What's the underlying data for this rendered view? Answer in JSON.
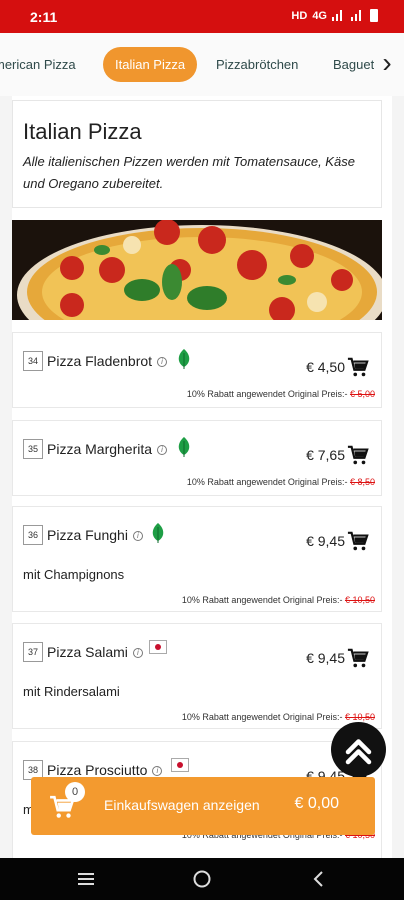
{
  "status": {
    "time": "2:11",
    "network": "4G"
  },
  "categories": {
    "tabs": [
      {
        "label": "merican Pizza"
      },
      {
        "label": "Italian Pizza"
      },
      {
        "label": "Pizzabrötchen"
      },
      {
        "label": "Baguette"
      }
    ],
    "active_index": 1
  },
  "header": {
    "title": "Italian Pizza",
    "description": "Alle italienischen Pizzen werden mit Tomatensauce, Käse und Oregano zubereitet."
  },
  "items": [
    {
      "number": "34",
      "name": "Pizza Fladenbrot",
      "badge": "vegetarian-leaf-icon",
      "price": "€ 4,50",
      "description": "",
      "discount_text": "10% Rabatt angewendet Original Preis:-",
      "original_price": "€ 5,00"
    },
    {
      "number": "35",
      "name": "Pizza Margherita",
      "badge": "vegetarian-leaf-icon",
      "price": "€ 7,65",
      "description": "",
      "discount_text": "10% Rabatt angewendet Original Preis:-",
      "original_price": "€ 8,50"
    },
    {
      "number": "36",
      "name": "Pizza Funghi",
      "badge": "vegetarian-leaf-icon",
      "price": "€ 9,45",
      "description": "mit Champignons",
      "discount_text": "10% Rabatt angewendet Original Preis:-",
      "original_price": "€ 10,50"
    },
    {
      "number": "37",
      "name": "Pizza Salami",
      "badge": "meat-flag-icon",
      "price": "€ 9,45",
      "description": "mit Rindersalami",
      "discount_text": "10% Rabatt angewendet Original Preis:-",
      "original_price": "€ 10,50"
    },
    {
      "number": "38",
      "name": "Pizza Prosciutto",
      "badge": "meat-flag-icon",
      "price": "€ 9,45",
      "description": "mit",
      "discount_text": "10% Rabatt angewendet Original Preis:-",
      "original_price": "€ 10,50"
    }
  ],
  "cart": {
    "count": "0",
    "label": "Einkaufswagen anzeigen",
    "total": "€ 0,00"
  },
  "colors": {
    "status_bar": "#d50f0f",
    "accent": "#f0962e",
    "cart_bar": "#f39a2f",
    "strike_price": "#d11111",
    "veg_leaf": "#1e9e45"
  }
}
